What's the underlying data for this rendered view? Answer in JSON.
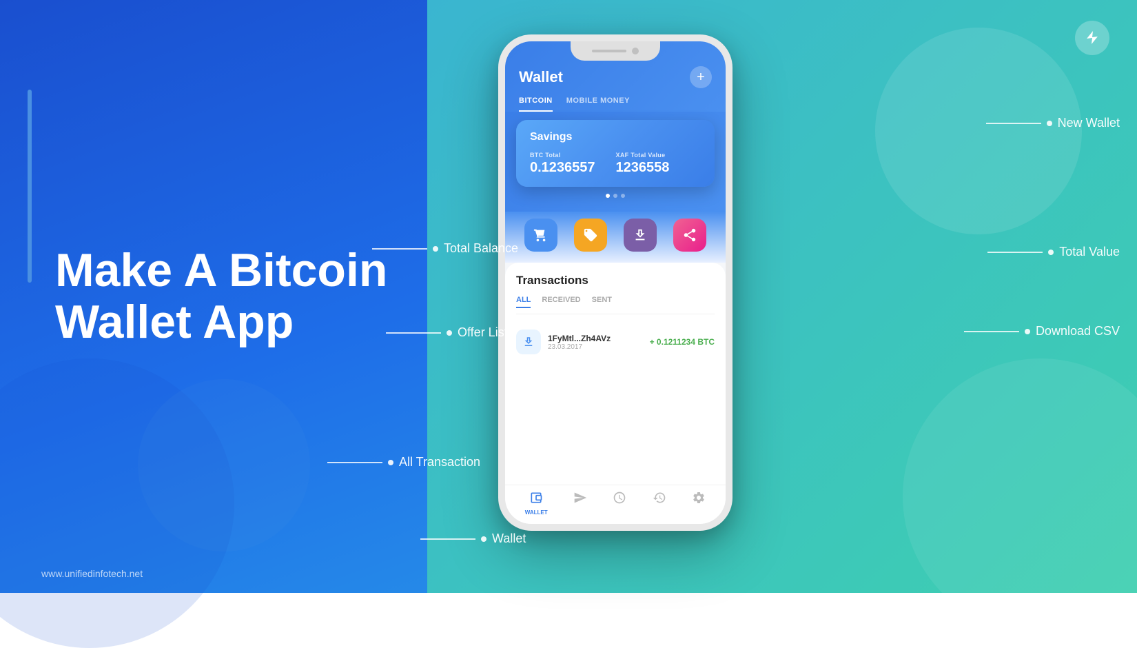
{
  "background": {
    "left_color": "#1a4fcf",
    "right_color": "#3ecfb0"
  },
  "left_section": {
    "title_line1": "Make A Bitcoin",
    "title_line2": "Wallet App",
    "website": "www.unifiedinfotech.net"
  },
  "brand": {
    "icon": "⚡"
  },
  "phone": {
    "header": {
      "title": "Wallet",
      "plus_button": "+",
      "tabs": [
        "BITCOIN",
        "MOBILE MONEY"
      ],
      "active_tab": "BITCOIN"
    },
    "card": {
      "name": "Savings",
      "btc_label": "BTC Total",
      "btc_value": "0.1236557",
      "xaf_label": "XAF Total Value",
      "xaf_value": "1236558"
    },
    "actions": [
      {
        "icon": "🛒",
        "color": "blue"
      },
      {
        "icon": "🏷️",
        "color": "yellow"
      },
      {
        "icon": "📥",
        "color": "purple"
      },
      {
        "icon": "📤",
        "color": "pink"
      }
    ],
    "transactions": {
      "title": "Transactions",
      "tabs": [
        "ALL",
        "RECEIVED",
        "SENT"
      ],
      "active_tab": "ALL",
      "items": [
        {
          "address": "1FyMtl...Zh4AVz",
          "date": "23.03.2017",
          "amount": "+ 0.1211234 BTC"
        }
      ]
    },
    "bottom_nav": [
      {
        "icon": "👛",
        "label": "WALLET",
        "active": true
      },
      {
        "icon": "↗️",
        "label": "",
        "active": false
      },
      {
        "icon": "🕐",
        "label": "",
        "active": false
      },
      {
        "icon": "🔄",
        "label": "",
        "active": false
      },
      {
        "icon": "⚙️",
        "label": "",
        "active": false
      }
    ]
  },
  "annotations": {
    "new_wallet": "New Wallet",
    "total_value": "Total Value",
    "download_csv": "Download CSV",
    "total_balance": "Total Balance",
    "offer_list": "Offer List",
    "all_transaction": "All Transaction",
    "wallet": "Wallet"
  }
}
